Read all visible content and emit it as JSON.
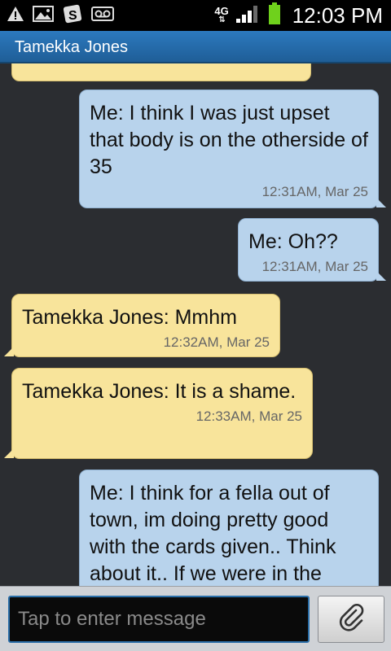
{
  "status_bar": {
    "network_type": "4G",
    "time": "12:03 PM"
  },
  "title_bar": {
    "title": "Tamekka Jones"
  },
  "messages": [
    {
      "direction": "outgoing",
      "text": "Me: I think I was just upset that body is on the otherside of 35",
      "time": "12:31AM, Mar 25"
    },
    {
      "direction": "outgoing",
      "text": "Me: Oh??",
      "time": "12:31AM, Mar 25"
    },
    {
      "direction": "incoming",
      "text": "Tamekka Jones: Mmhm",
      "time": "12:32AM, Mar 25"
    },
    {
      "direction": "incoming",
      "text": "Tamekka Jones: It is a shame.",
      "time": "12:33AM, Mar 25"
    },
    {
      "direction": "outgoing",
      "text": "Me: I think for a fella out of town, im doing pretty good with the cards given.. Think about it.. If we were in the",
      "time": ""
    }
  ],
  "input": {
    "placeholder": "Tap to enter message",
    "value": ""
  },
  "icons": {
    "status_left": [
      "warning-icon",
      "image-icon",
      "app-s-icon",
      "voicemail-icon"
    ],
    "status_right": [
      "signal-icon",
      "battery-icon"
    ],
    "attach": "paperclip-icon"
  },
  "colors": {
    "outgoing_bubble": "#b8d3ec",
    "incoming_bubble": "#f8e49b",
    "title_bar": "#2c79be",
    "background": "#2b2d31",
    "battery": "#6fd11c"
  }
}
